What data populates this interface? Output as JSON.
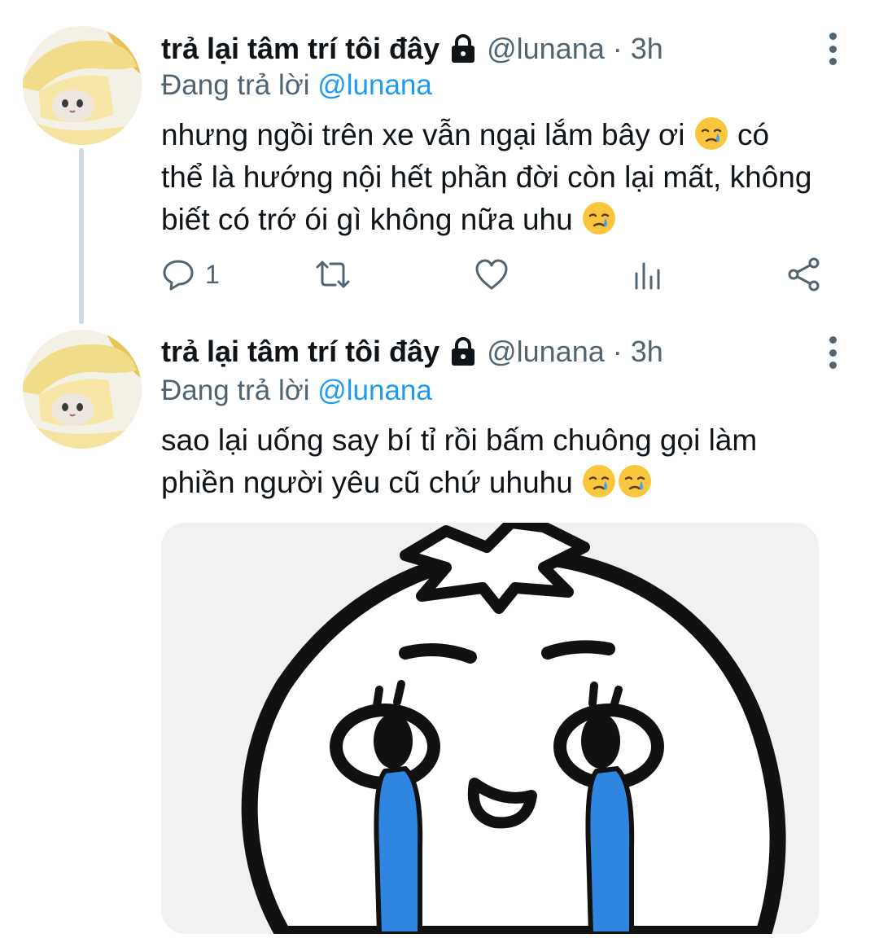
{
  "tweets": [
    {
      "display_name": "trả lại tâm trí tôi đây",
      "handle": "@lunana",
      "separator": "·",
      "time": "3h",
      "replying_prefix": "Đang trả lời",
      "replying_to": "@lunana",
      "text_lines": [
        "nhưng ngồi trên xe vẫn ngại lắm bây ơi",
        "có",
        "thể là hướng nội hết phần đời còn lại mất, không",
        "biết có trớ ói gì không nữa uhu"
      ],
      "emoji": "crying-face",
      "actions": {
        "reply_count": "1"
      }
    },
    {
      "display_name": "trả lại tâm trí tôi đây",
      "handle": "@lunana",
      "separator": "·",
      "time": "3h",
      "replying_prefix": "Đang trả lời",
      "replying_to": "@lunana",
      "text_lines": [
        "sao lại uống say bí tỉ rồi bấm chuông gọi làm",
        "phiền người yêu cũ chứ uhuhu"
      ],
      "emoji": "crying-face",
      "media": {
        "kind": "sticker",
        "description_icon": "crying-tomato-sticker"
      }
    }
  ],
  "colors": {
    "link_blue": "#1d9bf0",
    "secondary_text": "#536471",
    "tear_blue": "#2f86e0"
  }
}
